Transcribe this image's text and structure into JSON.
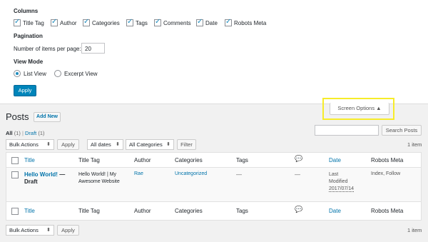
{
  "screen_options": {
    "columns_heading": "Columns",
    "columns": [
      {
        "label": "Title Tag",
        "checked": true
      },
      {
        "label": "Author",
        "checked": true
      },
      {
        "label": "Categories",
        "checked": true
      },
      {
        "label": "Tags",
        "checked": true
      },
      {
        "label": "Comments",
        "checked": true
      },
      {
        "label": "Date",
        "checked": true
      },
      {
        "label": "Robots Meta",
        "checked": true
      }
    ],
    "pagination_heading": "Pagination",
    "items_per_page_label": "Number of items per page:",
    "items_per_page_value": "20",
    "view_mode_heading": "View Mode",
    "view_modes": [
      {
        "label": "List View",
        "selected": true
      },
      {
        "label": "Excerpt View",
        "selected": false
      }
    ],
    "apply_label": "Apply",
    "toggle_label": "Screen Options ▲"
  },
  "page": {
    "title": "Posts",
    "add_new_label": "Add New",
    "filters": {
      "all_label": "All",
      "all_count": "(1)",
      "separator": "|",
      "draft_label": "Draft",
      "draft_count": "(1)"
    },
    "search_placeholder": "",
    "search_button": "Search Posts",
    "items_count": "1 item"
  },
  "toolbar": {
    "bulk_actions": "Bulk Actions",
    "apply_label": "Apply",
    "dates": "All dates",
    "categories": "All Categories",
    "filter_label": "Filter"
  },
  "table": {
    "columns": [
      "Title",
      "Title Tag",
      "Author",
      "Categories",
      "Tags",
      "comment-icon",
      "Date",
      "Robots Meta"
    ],
    "row": {
      "title": "Hello World!",
      "state": "— Draft",
      "title_tag_line1": "Hello World! | My",
      "title_tag_line2": "Awesome Website",
      "author": "Rae",
      "categories": "Uncategorized",
      "tags": "—",
      "comments": "—",
      "date_line1": "Last",
      "date_line2": "Modified",
      "date_line3": "2017/07/14",
      "robots_meta": "Index, Follow"
    }
  },
  "colors": {
    "accent": "#0073aa",
    "primary_button": "#0085ba",
    "highlight": "#f7ec2a"
  }
}
